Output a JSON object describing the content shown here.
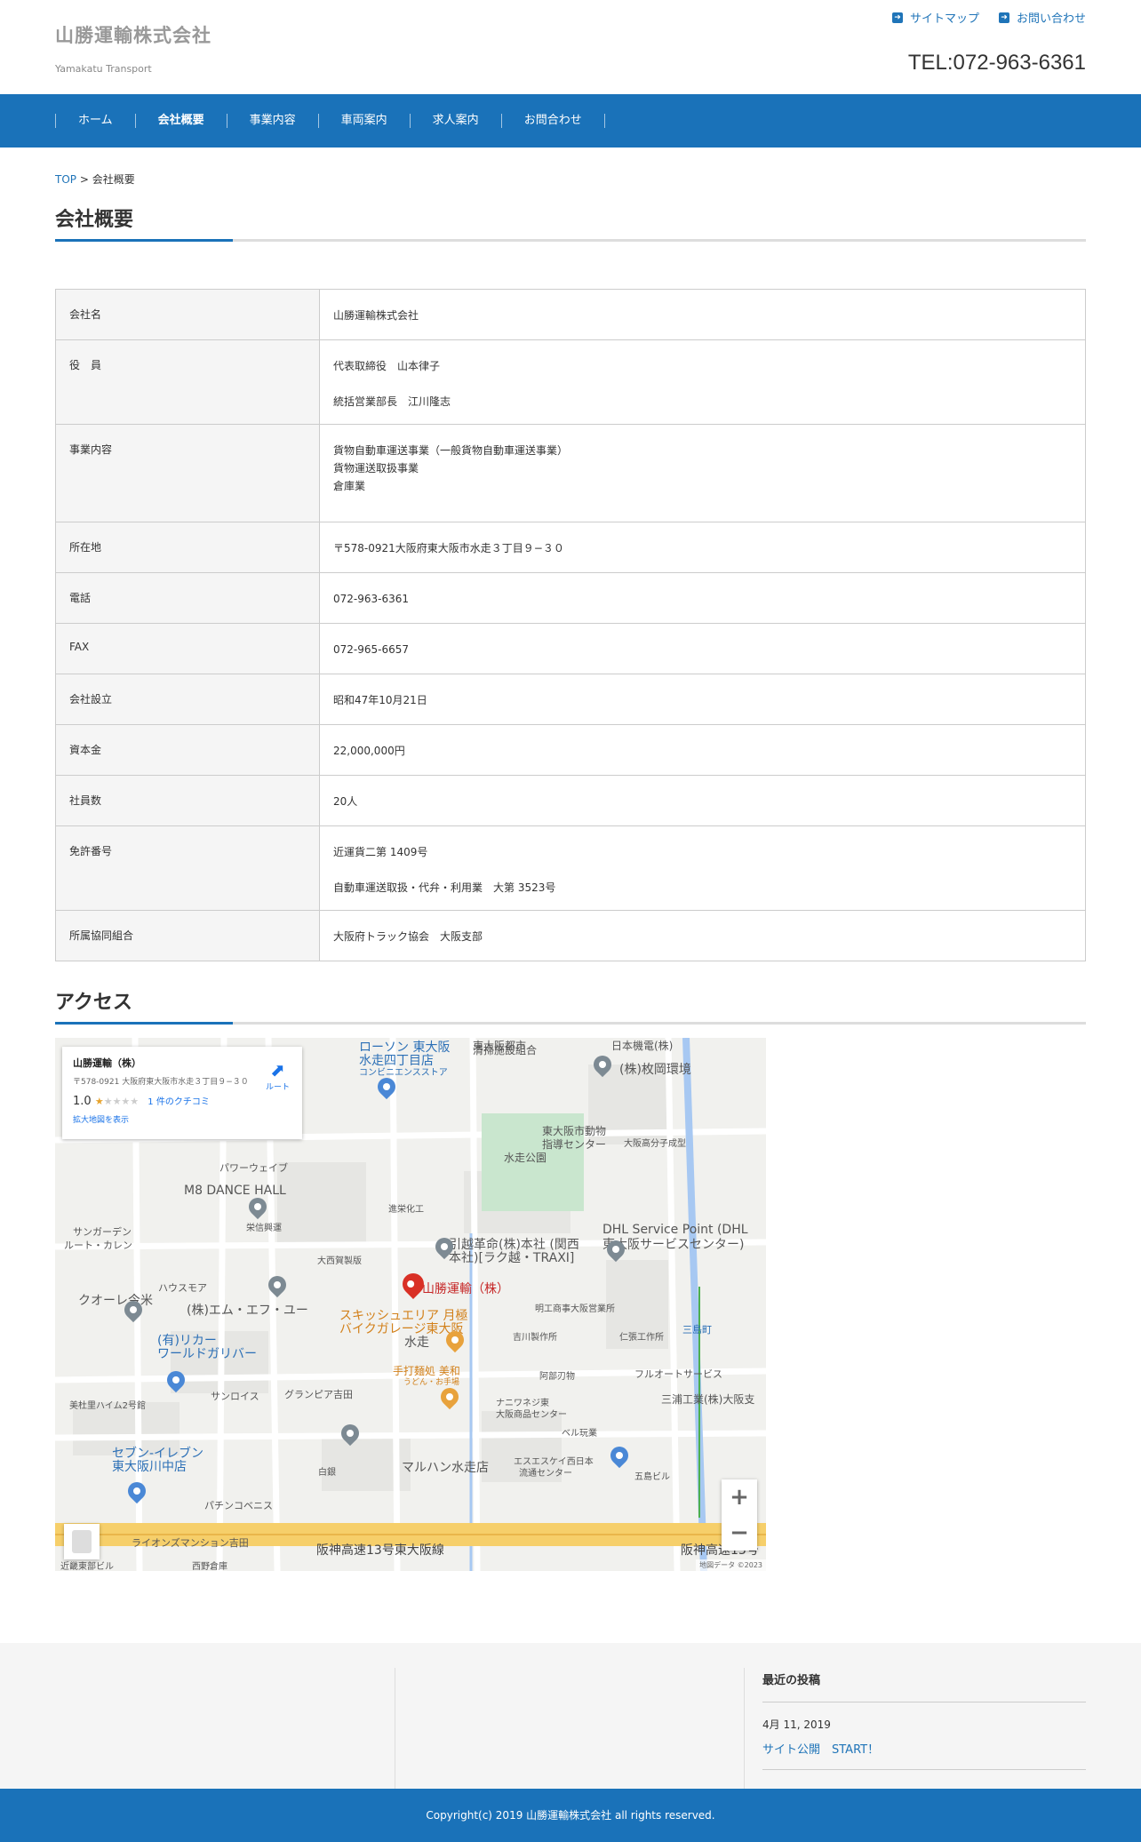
{
  "header": {
    "site_title": "山勝運輸株式会社",
    "site_subtitle": "Yamakatu Transport",
    "toplinks": [
      "サイトマップ",
      "お問い合わせ"
    ],
    "tel": "TEL:072-963-6361"
  },
  "nav": {
    "items": [
      "ホーム",
      "会社概要",
      "事業内容",
      "車両案内",
      "求人案内",
      "お問合わせ"
    ]
  },
  "breadcrumb": {
    "home": "TOP",
    "sep": ">",
    "current": "会社概要"
  },
  "page_title": "会社概要",
  "company_table": {
    "rows": [
      {
        "label": "会社名",
        "values": [
          "山勝運輸株式会社"
        ]
      },
      {
        "label": "役　員",
        "values": [
          "代表取締役　山本律子",
          "統括営業部長　江川隆志"
        ]
      },
      {
        "label": "事業内容",
        "values": [
          "貨物自動車運送事業（一般貨物自動車運送事業）",
          "貨物運送取扱事業",
          "倉庫業"
        ]
      },
      {
        "label": "所在地",
        "values": [
          "〒578-0921大阪府東大阪市水走３丁目９−３０"
        ]
      },
      {
        "label": "電話",
        "values": [
          "072-963-6361"
        ]
      },
      {
        "label": "FAX",
        "values": [
          "072-965-6657"
        ]
      },
      {
        "label": "会社設立",
        "values": [
          "昭和47年10月21日"
        ]
      },
      {
        "label": "資本金",
        "values": [
          "22,000,000円"
        ]
      },
      {
        "label": "社員数",
        "values": [
          "20人"
        ]
      },
      {
        "label": "免許番号",
        "values": [
          "近運貨二第 1409号",
          "自動車運送取扱・代弁・利用業　大第 3523号"
        ]
      },
      {
        "label": "所属協同組合",
        "values": [
          "大阪府トラック協会　大阪支部"
        ]
      }
    ]
  },
  "access_title": "アクセス",
  "map": {
    "card": {
      "title": "山勝運輸（株）",
      "address": "〒578-0921 大阪府東大阪市水走３丁目９−３０",
      "rating": "1.0",
      "reviews": "1 件のクチコミ",
      "larger_map": "拡大地図を表示",
      "directions": "ルート"
    },
    "labels": {
      "lawson": "ローソン 東大阪",
      "lawson2": "水走四丁目店",
      "conv": "コンビニエンスストア",
      "seiso": "東大阪都市",
      "seiso2": "清掃施設組合",
      "nihonkiden": "日本機電(株)",
      "hiraoka": "(株)枚岡環境",
      "zoo": "東大阪市動物",
      "zoo2": "指導センター",
      "bunshi": "大阪高分子成型",
      "park": "水走公園",
      "power": "パワーウェイブ",
      "m8": "M8 DANCE HALL",
      "shinei": "進栄化工",
      "sunga": "サンガーデン",
      "route": "ルート・カレン",
      "eishin": "栄信興運",
      "hiki": "引越革命(株)本社 (関西",
      "hiki2": "本社)[ラク越・TRAXI]",
      "dhl": "DHL Service Point (DHL",
      "dhl2": "東大阪サービスセンター)",
      "house": "ハウスモア",
      "daiei": "大西賀製版",
      "yamakatsu": "山勝運輸（株）",
      "kuore": "クオーレ今米",
      "mfu": "(株)エム・エフ・ユー",
      "squash": "スキッシュエリア 月極",
      "squash2": "バイクガレージ東大阪",
      "meiko": "明工商事大阪営業所",
      "liquor": "(有)リカー",
      "liquor2": "ワールドガリバー",
      "mizuhae": "水走",
      "yoshikawa": "吉川製作所",
      "jinchou": "仁張工作所",
      "udon": "手打麺処 美和",
      "udon2": "うどん・お手場",
      "abe": "阿部刃物",
      "fullauto": "フルオートサービス",
      "bisato": "美杜里ハイム2号館",
      "sunrise": "サンロイス",
      "grandpia": "グランピア吉田",
      "naniwa": "ナニワネジ東",
      "naniwa2": "大阪商品センター",
      "miura": "三浦工業(株)大阪支",
      "bell": "ベル玩業",
      "seven": "セブン-イレブン",
      "seven2": "東大阪川中店",
      "maruhan": "マルハン水走店",
      "ss": "エスエスケイ西日本",
      "ss2": "流通センター",
      "goshima": "五島ビル",
      "shiragane": "白銀",
      "pachinko": "パチンコベニス",
      "lions": "ライオンズマンション吉田",
      "hanshin": "阪神高速13号東大阪線",
      "hanshin2": "阪神高速13号",
      "daiichi": "三島町",
      "kinryu": "近畿東部ビル",
      "nishino": "西野倉庫"
    },
    "footer": "地図データ ©2023"
  },
  "footer": {
    "recent_title": "最近の投稿",
    "post_date": "4月 11, 2019",
    "post_title": "サイト公開　START！",
    "copyright": "Copyright(c) 2019 山勝運輸株式会社 all rights reserved."
  }
}
